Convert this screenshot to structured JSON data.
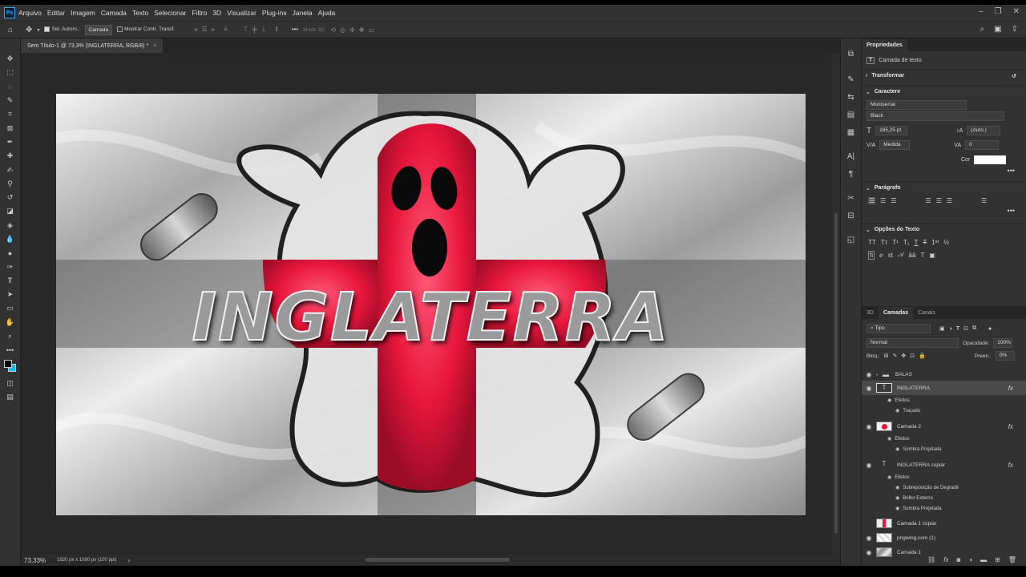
{
  "app": {
    "logo": "Ps",
    "menu": [
      "Arquivo",
      "Editar",
      "Imagem",
      "Camada",
      "Texto",
      "Selecionar",
      "Filtro",
      "3D",
      "Visualizar",
      "Plug-ins",
      "Janela",
      "Ajuda"
    ],
    "window_controls": [
      "minimize-icon",
      "restore-icon",
      "close-icon"
    ]
  },
  "options_bar": {
    "auto_select_label": "Sel. Autom.:",
    "auto_select_checked": true,
    "auto_select_target": "Camada",
    "show_transform_label": "Mostrar Contr. Transf.",
    "show_transform_checked": false,
    "mode_3d_label": "Modo 3D:"
  },
  "document": {
    "tab_title": "Sem Título-1 @ 73,3% (INGLATERRA, RGB/8) *",
    "zoom": "73,33%",
    "info": "1920 px x 1080 px (100 ppi)"
  },
  "artwork": {
    "title_text": "INGLATERRA",
    "accent_color": "#e8163c"
  },
  "properties": {
    "panel_title": "Propriedades",
    "layer_kind": "Camada de texto",
    "transform_label": "Transformar",
    "character_label": "Caractere",
    "font_family": "Montserrat",
    "font_style": "Black",
    "font_size": "165,25 pt",
    "leading": "(Auto.)",
    "kerning": "Medida",
    "tracking": "0",
    "color_label": "Cor",
    "text_color": "#ffffff",
    "paragraph_label": "Parágrafo",
    "text_options_label": "Opções do Texto"
  },
  "layers_panel": {
    "tabs": [
      "3D",
      "Camadas",
      "Canais"
    ],
    "active_tab": "Camadas",
    "filter": "Tipo",
    "blend_mode": "Normal",
    "opacity_label": "Opacidade:",
    "opacity": "100%",
    "lock_label": "Bloq.:",
    "fill_label": "Preen.:",
    "fill": "0%",
    "layers": [
      {
        "name": "BALAS",
        "kind": "group",
        "visible": true
      },
      {
        "name": "INGLATERRA",
        "kind": "text",
        "visible": true,
        "fx": "fx",
        "effects_label": "Efeitos",
        "effects": [
          "Traçado"
        ]
      },
      {
        "name": "Camada 2",
        "kind": "pixel",
        "visible": true,
        "fx": "fx",
        "effects_label": "Efeitos",
        "effects": [
          "Sombra Projetada"
        ]
      },
      {
        "name": "INGLATERRA copiar",
        "kind": "text",
        "visible": true,
        "fx": "fx",
        "effects_label": "Efeitos",
        "effects": [
          "Sobreposição de Degradê",
          "Brilho Externo",
          "Sombra Projetada"
        ]
      },
      {
        "name": "Camada 1 copiar",
        "kind": "pixel",
        "visible": false
      },
      {
        "name": "pngwing.com (1)",
        "kind": "pixel",
        "visible": true
      },
      {
        "name": "Camada 1",
        "kind": "pixel",
        "visible": true
      }
    ]
  }
}
